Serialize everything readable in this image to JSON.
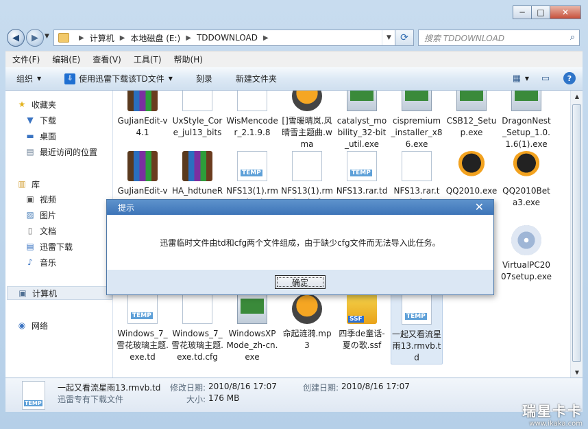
{
  "window": {
    "minimize_glyph": "─",
    "maximize_glyph": "□",
    "close_glyph": "✕"
  },
  "nav": {
    "back_glyph": "◀",
    "forward_glyph": "▶",
    "breadcrumbs": [
      "计算机",
      "本地磁盘 (E:)",
      "TDDOWNLOAD"
    ],
    "search_placeholder": "搜索 TDDOWNLOAD"
  },
  "menubar": [
    "文件(F)",
    "编辑(E)",
    "查看(V)",
    "工具(T)",
    "帮助(H)"
  ],
  "commandbar": {
    "organize": "组织",
    "xunlei": "使用迅雷下载该TD文件",
    "burn": "刻录",
    "new_folder": "新建文件夹",
    "icons": [
      "view-options-icon",
      "preview-pane-icon",
      "help-icon"
    ]
  },
  "sidebar": {
    "favorites_header": "收藏夹",
    "favorites": [
      "下载",
      "桌面",
      "最近访问的位置"
    ],
    "libraries_header": "库",
    "libraries": [
      "视频",
      "图片",
      "文档",
      "迅雷下载",
      "音乐"
    ],
    "computer": "计算机",
    "network": "网络"
  },
  "files": [
    {
      "name": "GuJianEdit-v4.1",
      "icon": "rar"
    },
    {
      "name": "UxStyle_Core_jul13_bits",
      "icon": "blank"
    },
    {
      "name": "WisMencoder_2.1.9.8",
      "icon": "blank"
    },
    {
      "name": "[]雪暖晴岚.风晴雪主题曲.wma",
      "icon": "music"
    },
    {
      "name": "catalyst_mobility_32-bit_util.exe",
      "icon": "app"
    },
    {
      "name": "cispremium_installer_x86.exe",
      "icon": "app"
    },
    {
      "name": "CSB12_Setup.exe",
      "icon": "app"
    },
    {
      "name": "DragonNest_Setup_1.0.1.6(1).exe",
      "icon": "app"
    },
    {
      "name": "GuJianEdit-v4.1",
      "icon": "rar"
    },
    {
      "name": "HA_hdtuneRPO_27 ZH",
      "icon": "rar"
    },
    {
      "name": "NFS13(1).rmvb.td",
      "icon": "temp"
    },
    {
      "name": "NFS13(1).rmvb.td.cfg",
      "icon": "blank"
    },
    {
      "name": "NFS13.rar.td",
      "icon": "temp"
    },
    {
      "name": "NFS13.rar.td.cfg",
      "icon": "blank"
    },
    {
      "name": "QQ2010.exe",
      "icon": "qq"
    },
    {
      "name": "QQ2010Beta3.exe",
      "icon": "qq"
    },
    {
      "name": "VirtualPC2007setup.exe",
      "icon": "cd"
    },
    {
      "name": "Windows_7_雪花玻璃主题.exe.td",
      "icon": "temp"
    },
    {
      "name": "Windows_7_雪花玻璃主题.exe.td.cfg",
      "icon": "blank"
    },
    {
      "name": "WindowsXPMode_zh-cn.exe",
      "icon": "app"
    },
    {
      "name": "命起涟漪.mp3",
      "icon": "music"
    },
    {
      "name": "四季de童话-夏の歌.ssf",
      "icon": "ssf"
    },
    {
      "name": "一起又看流星雨13.rmvb.td",
      "icon": "temp"
    }
  ],
  "details": {
    "filename": "一起又看流星雨13.rmvb.td",
    "type": "迅雷专有下载文件",
    "modified_label": "修改日期:",
    "modified": "2010/8/16 17:07",
    "created_label": "创建日期:",
    "created": "2010/8/16 17:07",
    "size_label": "大小:",
    "size": "176 MB"
  },
  "dialog": {
    "title": "提示",
    "message": "迅雷临时文件由td和cfg两个文件组成，由于缺少cfg文件而无法导入此任务。",
    "ok": "确定",
    "close_glyph": "✕"
  },
  "watermark": {
    "main": "瑞星卡卡",
    "url": "www.ikaka.com"
  }
}
